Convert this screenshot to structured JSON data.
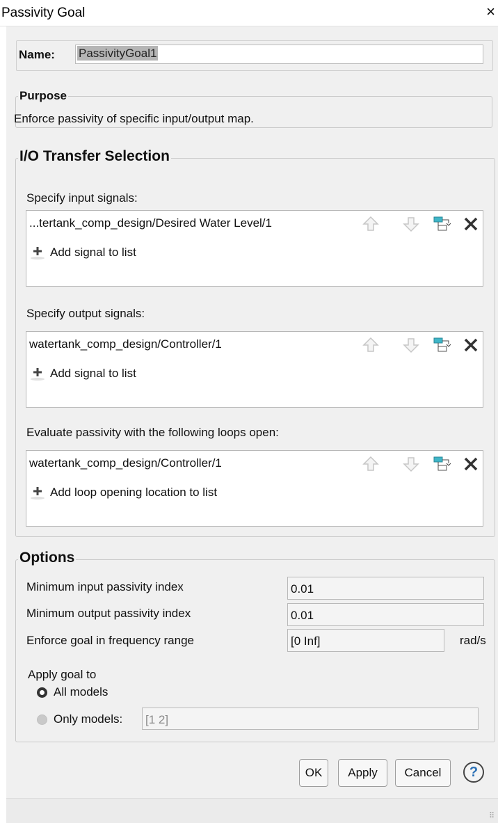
{
  "window": {
    "title": "Passivity Goal",
    "close_label": "×"
  },
  "name": {
    "label": "Name:",
    "value": "PassivityGoal1"
  },
  "purpose": {
    "legend": "Purpose",
    "text": "Enforce passivity of specific input/output map."
  },
  "io": {
    "legend": "I/O Transfer Selection",
    "inputs": {
      "label": "Specify input signals:",
      "entry": "...tertank_comp_design/Desired  Water Level/1",
      "add": "Add signal to list"
    },
    "outputs": {
      "label": "Specify output signals:",
      "entry": "watertank_comp_design/Controller/1",
      "add": "Add signal to list"
    },
    "loops": {
      "label": "Evaluate passivity with the following loops open:",
      "entry": "watertank_comp_design/Controller/1",
      "add": "Add loop opening location to list"
    }
  },
  "options": {
    "legend": "Options",
    "min_input": {
      "label": "Minimum input passivity index",
      "value": "0.01"
    },
    "min_output": {
      "label": "Minimum output passivity index",
      "value": "0.01"
    },
    "freq_range": {
      "label": "Enforce goal in frequency range",
      "value": "[0 Inf]",
      "unit": "rad/s"
    },
    "apply_goal": {
      "label": "Apply goal to",
      "all_models": "All models",
      "only_models": "Only models:",
      "only_models_value": "[1 2]",
      "selected": "all_models"
    }
  },
  "buttons": {
    "ok": "OK",
    "apply": "Apply",
    "cancel": "Cancel",
    "help": "?"
  },
  "icons": [
    "move-up-icon",
    "move-down-icon",
    "select-signal-icon",
    "delete-icon",
    "add-icon",
    "help-icon"
  ],
  "colors": {
    "selection_bg": "#b5b5b5",
    "dialog_bg": "#f0f0f0",
    "icon_teal": "#3fb6c8"
  }
}
